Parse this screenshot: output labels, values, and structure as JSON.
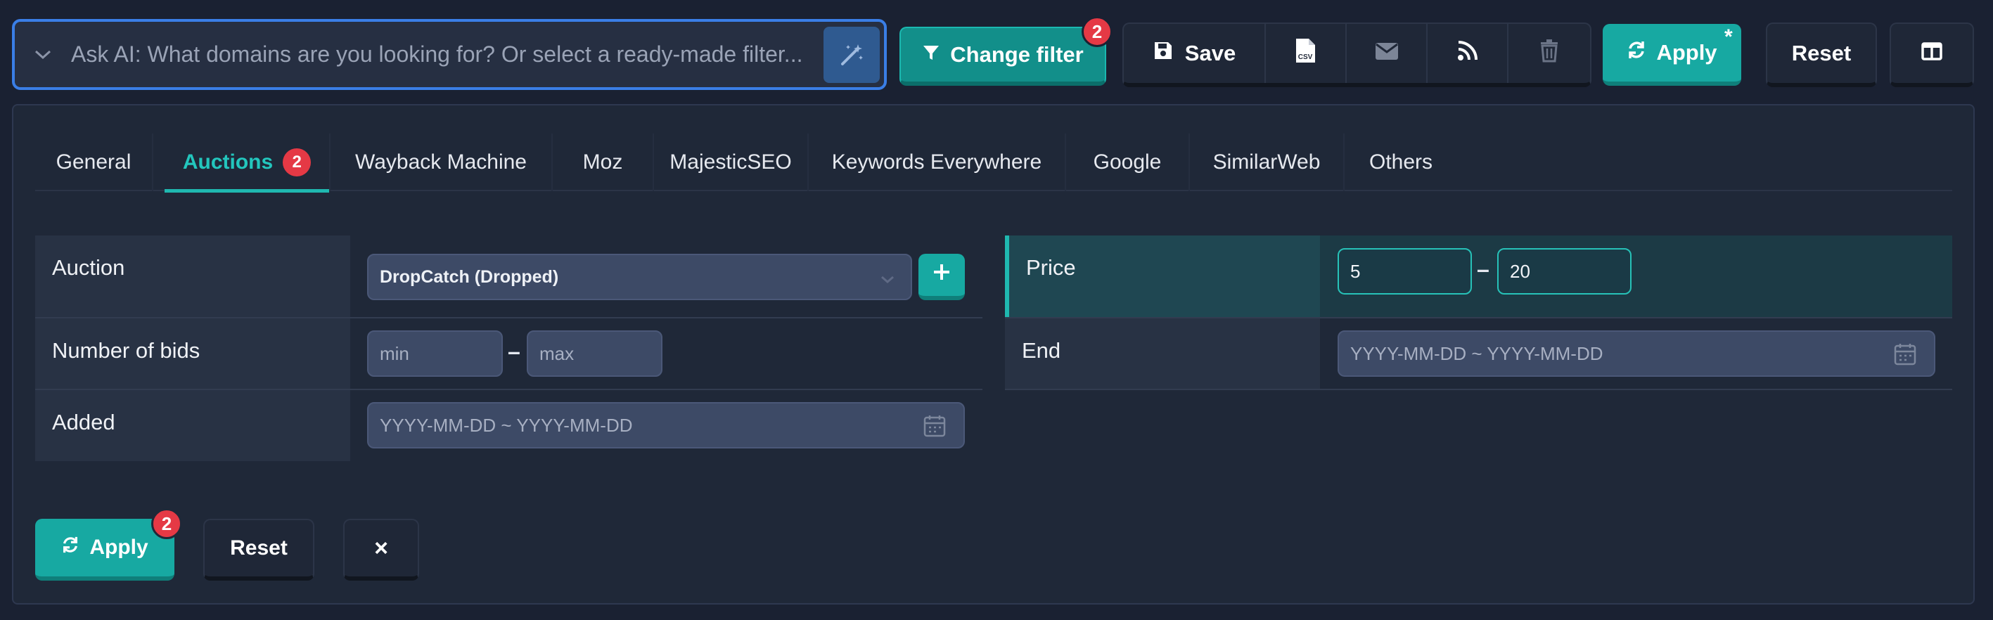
{
  "toolbar": {
    "ai_placeholder": "Ask AI: What domains are you looking for? Or select a ready-made filter...",
    "change_filter_label": "Change filter",
    "change_filter_badge": "2",
    "save_label": "Save",
    "apply_label": "Apply",
    "apply_mark": "*",
    "reset_label": "Reset",
    "icons": [
      "chevron-down-icon",
      "magic-wand-icon",
      "filter-icon",
      "save-icon",
      "csv-file-icon",
      "mail-icon",
      "rss-icon",
      "trash-icon",
      "refresh-icon",
      "columns-icon"
    ]
  },
  "tabs": [
    {
      "label": "General"
    },
    {
      "label": "Auctions",
      "badge": "2",
      "active": true
    },
    {
      "label": "Wayback Machine"
    },
    {
      "label": "Moz"
    },
    {
      "label": "MajesticSEO"
    },
    {
      "label": "Keywords Everywhere"
    },
    {
      "label": "Google"
    },
    {
      "label": "SimilarWeb"
    },
    {
      "label": "Others"
    }
  ],
  "form": {
    "auction": {
      "label": "Auction",
      "value": "DropCatch (Dropped)"
    },
    "bids": {
      "label": "Number of bids",
      "min_placeholder": "min",
      "max_placeholder": "max"
    },
    "added": {
      "label": "Added",
      "placeholder": "YYYY-MM-DD ~ YYYY-MM-DD"
    },
    "price": {
      "label": "Price",
      "min": "5",
      "max": "20"
    },
    "end": {
      "label": "End",
      "placeholder": "YYYY-MM-DD ~ YYYY-MM-DD"
    },
    "dash": "–"
  },
  "footer": {
    "apply_label": "Apply",
    "apply_badge": "2",
    "reset_label": "Reset",
    "close_label": "×"
  },
  "colors": {
    "accent": "#17a9a2",
    "badge": "#e53945",
    "focus": "#3a7ee6",
    "background": "#1a2132"
  }
}
